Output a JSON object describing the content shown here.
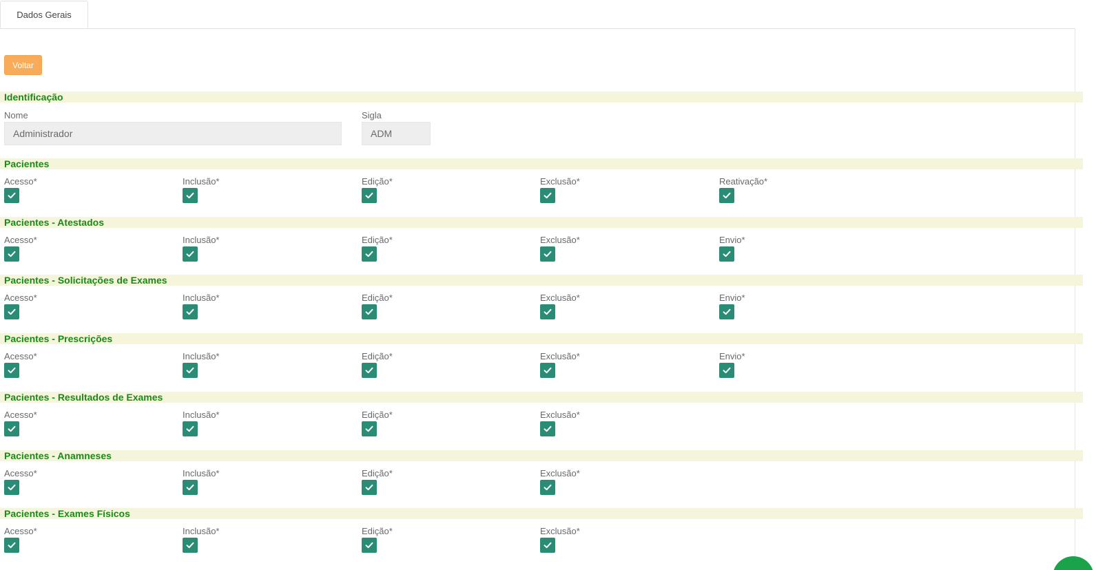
{
  "tabs": [
    {
      "label": "Dados Gerais"
    }
  ],
  "buttons": {
    "back_label": "Voltar"
  },
  "identification": {
    "title": "Identificação",
    "name_label": "Nome",
    "name_value": "Administrador",
    "acronym_label": "Sigla",
    "acronym_value": "ADM"
  },
  "colors": {
    "section_bg": "#f5f5dc",
    "section_text": "#1a8a17",
    "checkbox": "#2a8c74",
    "back_button": "#f8ac59"
  },
  "sections": [
    {
      "title": "Pacientes",
      "permissions": [
        {
          "label": "Acesso*",
          "checked": true
        },
        {
          "label": "Inclusão*",
          "checked": true
        },
        {
          "label": "Edição*",
          "checked": true
        },
        {
          "label": "Exclusão*",
          "checked": true
        },
        {
          "label": "Reativação*",
          "checked": true
        }
      ]
    },
    {
      "title": "Pacientes - Atestados",
      "permissions": [
        {
          "label": "Acesso*",
          "checked": true
        },
        {
          "label": "Inclusão*",
          "checked": true
        },
        {
          "label": "Edição*",
          "checked": true
        },
        {
          "label": "Exclusão*",
          "checked": true
        },
        {
          "label": "Envio*",
          "checked": true
        }
      ]
    },
    {
      "title": "Pacientes - Solicitações de Exames",
      "permissions": [
        {
          "label": "Acesso*",
          "checked": true
        },
        {
          "label": "Inclusão*",
          "checked": true
        },
        {
          "label": "Edição*",
          "checked": true
        },
        {
          "label": "Exclusão*",
          "checked": true
        },
        {
          "label": "Envio*",
          "checked": true
        }
      ]
    },
    {
      "title": "Pacientes - Prescrições",
      "permissions": [
        {
          "label": "Acesso*",
          "checked": true
        },
        {
          "label": "Inclusão*",
          "checked": true
        },
        {
          "label": "Edição*",
          "checked": true
        },
        {
          "label": "Exclusão*",
          "checked": true
        },
        {
          "label": "Envio*",
          "checked": true
        }
      ]
    },
    {
      "title": "Pacientes - Resultados de Exames",
      "permissions": [
        {
          "label": "Acesso*",
          "checked": true
        },
        {
          "label": "Inclusão*",
          "checked": true
        },
        {
          "label": "Edição*",
          "checked": true
        },
        {
          "label": "Exclusão*",
          "checked": true
        }
      ]
    },
    {
      "title": "Pacientes - Anamneses",
      "permissions": [
        {
          "label": "Acesso*",
          "checked": true
        },
        {
          "label": "Inclusão*",
          "checked": true
        },
        {
          "label": "Edição*",
          "checked": true
        },
        {
          "label": "Exclusão*",
          "checked": true
        }
      ]
    },
    {
      "title": "Pacientes - Exames Físicos",
      "permissions": [
        {
          "label": "Acesso*",
          "checked": true
        },
        {
          "label": "Inclusão*",
          "checked": true
        },
        {
          "label": "Edição*",
          "checked": true
        },
        {
          "label": "Exclusão*",
          "checked": true
        }
      ]
    }
  ]
}
